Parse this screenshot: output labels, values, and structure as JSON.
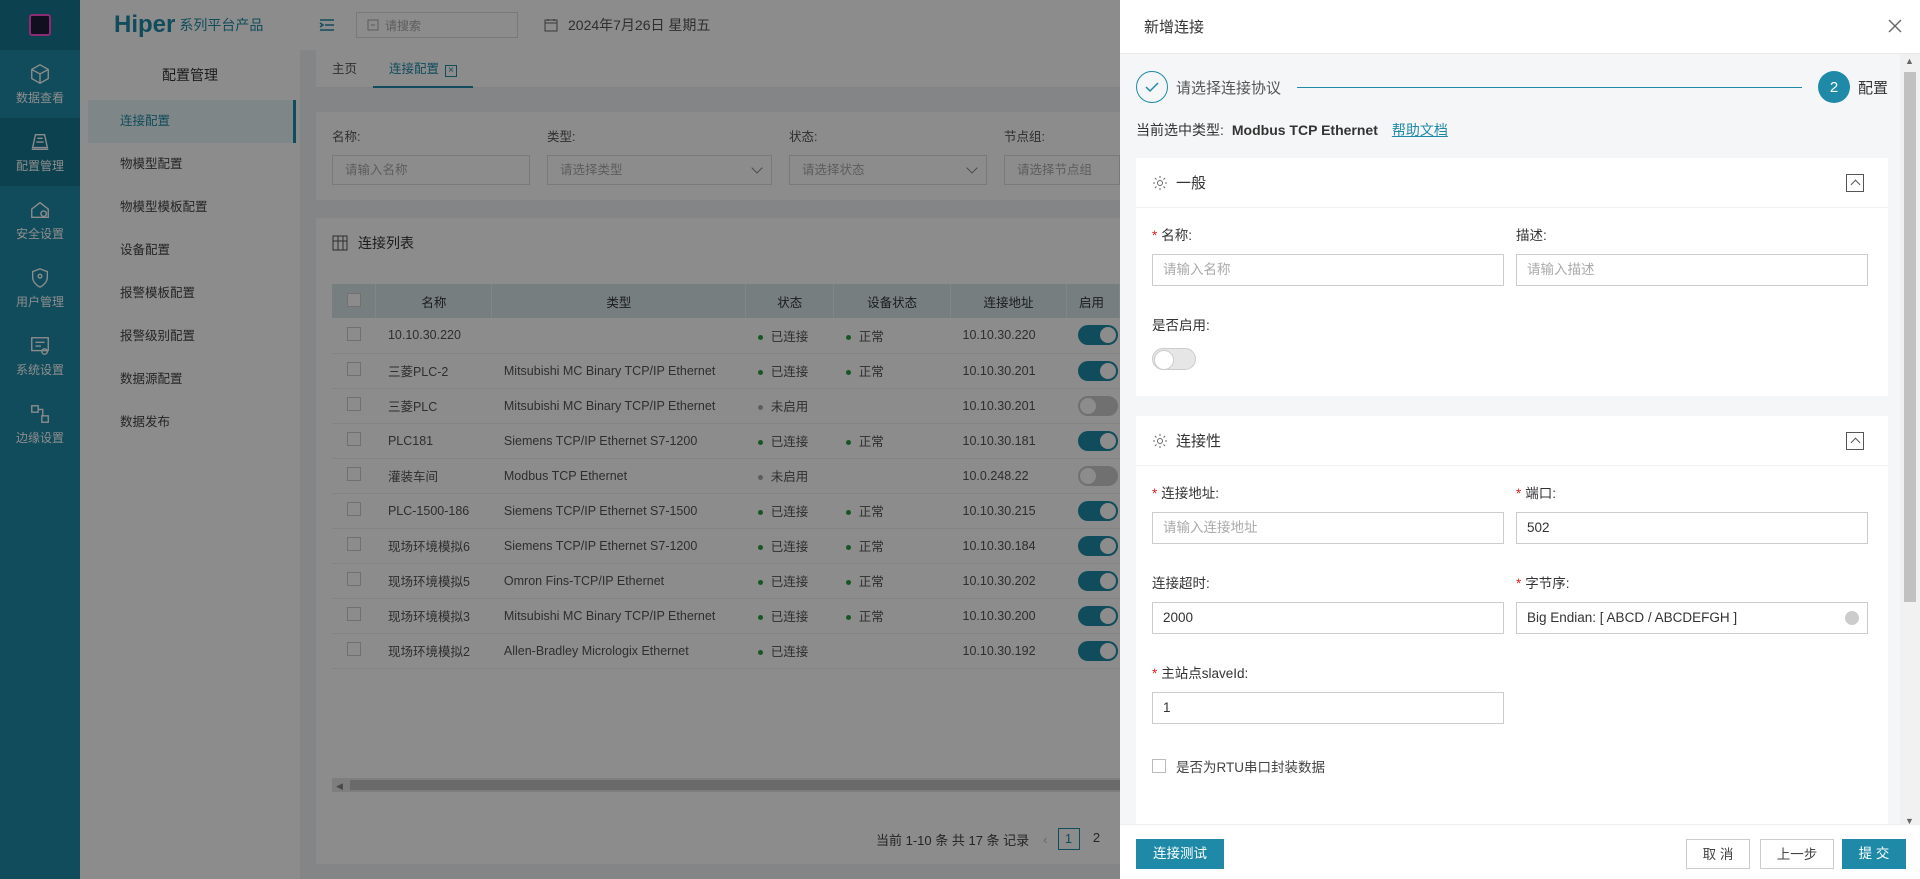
{
  "rail": {
    "items": [
      {
        "label": "数据查看"
      },
      {
        "label": "配置管理"
      },
      {
        "label": "安全设置"
      },
      {
        "label": "用户管理"
      },
      {
        "label": "系统设置"
      },
      {
        "label": "边缘设置"
      }
    ]
  },
  "brand": {
    "name": "Hiper",
    "sub": "系列平台产品"
  },
  "submenu": {
    "title": "配置管理",
    "items": [
      {
        "label": "连接配置"
      },
      {
        "label": "物模型配置"
      },
      {
        "label": "物模型模板配置"
      },
      {
        "label": "设备配置"
      },
      {
        "label": "报警模板配置"
      },
      {
        "label": "报警级别配置"
      },
      {
        "label": "数据源配置"
      },
      {
        "label": "数据发布"
      }
    ]
  },
  "topbar": {
    "search_placeholder": "请搜索",
    "date": "2024年7月26日 星期五"
  },
  "tabs": {
    "home": "主页",
    "active": "连接配置"
  },
  "filters": {
    "name_label": "名称:",
    "name_placeholder": "请输入名称",
    "type_label": "类型:",
    "type_placeholder": "请选择类型",
    "status_label": "状态:",
    "status_placeholder": "请选择状态",
    "group_label": "节点组:",
    "group_placeholder": "请选择节点组"
  },
  "list": {
    "title": "连接列表",
    "columns": {
      "name": "名称",
      "type": "类型",
      "status": "状态",
      "device_status": "设备状态",
      "address": "连接地址",
      "enabled": "启用"
    },
    "rows": [
      {
        "name": "10.10.30.220",
        "type": "",
        "status": "已连接",
        "device_status": "正常",
        "address": "10.10.30.220",
        "on": true
      },
      {
        "name": "三菱PLC-2",
        "type": "Mitsubishi MC Binary TCP/IP Ethernet",
        "status": "已连接",
        "device_status": "正常",
        "address": "10.10.30.201",
        "on": true
      },
      {
        "name": "三菱PLC",
        "type": "Mitsubishi MC Binary TCP/IP Ethernet",
        "status": "未启用",
        "device_status": "",
        "address": "10.10.30.201",
        "on": false
      },
      {
        "name": "PLC181",
        "type": "Siemens TCP/IP Ethernet S7-1200",
        "status": "已连接",
        "device_status": "正常",
        "address": "10.10.30.181",
        "on": true
      },
      {
        "name": "灌装车间",
        "type": "Modbus TCP Ethernet",
        "status": "未启用",
        "device_status": "",
        "address": "10.0.248.22",
        "on": false
      },
      {
        "name": "PLC-1500-186",
        "type": "Siemens TCP/IP Ethernet S7-1500",
        "status": "已连接",
        "device_status": "正常",
        "address": "10.10.30.215",
        "on": true
      },
      {
        "name": "现场环境模拟6",
        "type": "Siemens TCP/IP Ethernet S7-1200",
        "status": "已连接",
        "device_status": "正常",
        "address": "10.10.30.184",
        "on": true
      },
      {
        "name": "现场环境模拟5",
        "type": "Omron Fins-TCP/IP Ethernet",
        "status": "已连接",
        "device_status": "正常",
        "address": "10.10.30.202",
        "on": true
      },
      {
        "name": "现场环境模拟3",
        "type": "Mitsubishi MC Binary TCP/IP Ethernet",
        "status": "已连接",
        "device_status": "正常",
        "address": "10.10.30.200",
        "on": true
      },
      {
        "name": "现场环境模拟2",
        "type": "Allen-Bradley Micrologix Ethernet",
        "status": "已连接",
        "device_status": "",
        "address": "10.10.30.192",
        "on": true
      }
    ],
    "pager_text": "当前 1-10 条 共 17 条 记录",
    "pages": [
      "1",
      "2"
    ]
  },
  "drawer": {
    "title": "新增连接",
    "step1": "请选择连接协议",
    "step2_num": "2",
    "step2": "配置",
    "cur_type_label": "当前选中类型:",
    "cur_type_value": "Modbus TCP Ethernet",
    "help_link": "帮助文档",
    "general": {
      "title": "一般",
      "name_label": "名称:",
      "name_placeholder": "请输入名称",
      "desc_label": "描述:",
      "desc_placeholder": "请输入描述",
      "enable_label": "是否启用:"
    },
    "conn": {
      "title": "连接性",
      "addr_label": "连接地址:",
      "addr_placeholder": "请输入连接地址",
      "port_label": "端口:",
      "port_value": "502",
      "timeout_label": "连接超时:",
      "timeout_value": "2000",
      "byteorder_label": "字节序:",
      "byteorder_value": "Big Endian: [ ABCD / ABCDEFGH ]",
      "slave_label": "主站点slaveId:",
      "slave_value": "1",
      "rtu_label": "是否为RTU串口封装数据"
    },
    "footer": {
      "test": "连接测试",
      "cancel": "取 消",
      "prev": "上一步",
      "submit": "提 交"
    }
  },
  "colors": {
    "accent": "#1f8aa8",
    "ok": "#2a9d3f",
    "required": "#e02020"
  }
}
